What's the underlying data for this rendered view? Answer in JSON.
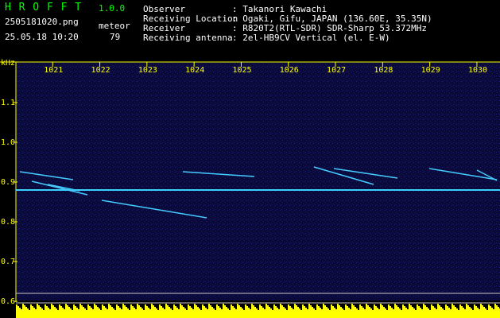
{
  "header": {
    "app_name": "H R O F F T",
    "version": "1.0.0",
    "filename": "2505181020.png",
    "mode_label": "meteor",
    "datetime": "25.05.18 10:20",
    "count": "79",
    "observer_label": "Observer",
    "observer_value": ": Takanori Kawachi",
    "location_label": "Receiving Location",
    "location_value": ": Ogaki, Gifu, JAPAN (136.60E, 35.35N)",
    "receiver_label": "Receiver",
    "receiver_value": ": R820T2(RTL-SDR) SDR-Sharp 53.372MHz",
    "antenna_label": "Receiving antenna",
    "antenna_value": ": 2el-HB9CV Vertical (el. E-W)"
  },
  "chart_data": {
    "type": "heatmap",
    "xlabel": "",
    "ylabel": "kHz",
    "x_ticks": [
      "1021",
      "1022",
      "1023",
      "1024",
      "1025",
      "1026",
      "1027",
      "1028",
      "1029",
      "1030"
    ],
    "y_ticks": [
      "1.1",
      "1.0",
      "0.9",
      "0.8",
      "0.7",
      "0.6"
    ],
    "ylim": [
      0.6,
      1.15
    ],
    "carrier_khz": 0.88,
    "colors": {
      "background": "#0a0a3a",
      "text": "#ffff00",
      "header_green": "#00ff00"
    }
  }
}
